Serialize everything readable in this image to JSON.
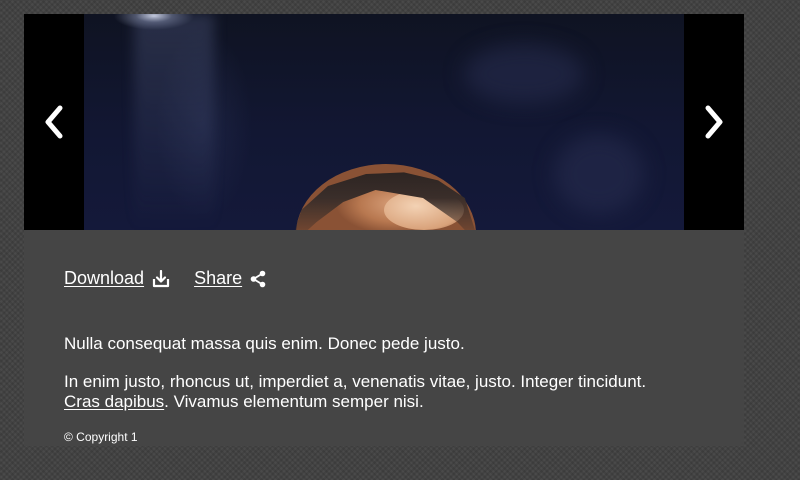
{
  "slideshow": {
    "prev_icon": "chevron-left-icon",
    "next_icon": "chevron-right-icon"
  },
  "actions": {
    "download_label": "Download",
    "download_icon": "download-icon",
    "share_label": "Share",
    "share_icon": "share-icon"
  },
  "caption": {
    "paragraph1": "Nulla consequat massa quis enim. Donec pede justo.",
    "paragraph2_before_link": "In enim justo, rhoncus ut, imperdiet a, venenatis vitae, justo. Integer tincidunt.",
    "paragraph2_link": "Cras dapibus",
    "paragraph2_after_link": ". Vivamus elementum semper nisi."
  },
  "copyright": "© Copyright 1",
  "colors": {
    "page_background": "#4a4a4a",
    "card_background": "#454545",
    "nav_background": "#000000",
    "text": "#ffffff"
  }
}
